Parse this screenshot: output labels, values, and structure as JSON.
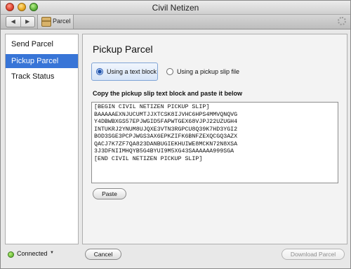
{
  "window": {
    "title": "Civil Netizen"
  },
  "toolbar": {
    "back_glyph": "◀",
    "forward_glyph": "▶",
    "tab_label": "Parcel",
    "tab_icon": "package-icon"
  },
  "sidebar": {
    "items": [
      {
        "label": "Send Parcel",
        "selected": false
      },
      {
        "label": "Pickup Parcel",
        "selected": true
      },
      {
        "label": "Track Status",
        "selected": false
      }
    ]
  },
  "main": {
    "heading": "Pickup Parcel",
    "options": {
      "text_block": "Using a text block",
      "slip_file": "Using a pickup slip file",
      "selected": "text_block"
    },
    "instruction": "Copy the pickup slip text block and paste it below",
    "slip_text": "[BEGIN CIVIL NETIZEN PICKUP SLIP]\nBAAAAAEXNJUCUMTJJXTCSK8IJVHC6HPS4MMVQNQVG\nY4DBWBXGS57EPJWGID5FAPWTGEX68VJPJ22UZUGH4\nINTUKRJ2YNUM8UJQXE3VTN3RGPCU8Q39K7HD3YGI2\nBOD3SGE3PCPJWGS3AX6EPKZIFK6BNFZEXQCGQ3AZX\nQACJ7K7ZF7QA823DANBUGIEKHUIWE8MCKN72N8XSA\n3J3DFNIIMHQYB5G4BYUI9M5XG43SAAAAAA999SGA\n[END CIVIL NETIZEN PICKUP SLIP]",
    "paste_label": "Paste"
  },
  "footer": {
    "status": "Connected",
    "cancel_label": "Cancel",
    "download_label": "Download Parcel",
    "download_enabled": false
  }
}
